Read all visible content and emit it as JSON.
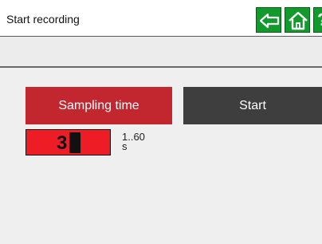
{
  "header": {
    "title": "Start recording",
    "back_icon": "arrow-left-icon",
    "home_icon": "home-icon",
    "help_label": "?",
    "accent_color": "#129b2c"
  },
  "main": {
    "sampling_button_label": "Sampling time",
    "start_button_label": "Start",
    "sampling_value": "3",
    "range_label": "1..60",
    "unit_label": "s",
    "sampling_color": "#c2262f",
    "field_color": "#ee1c24"
  }
}
